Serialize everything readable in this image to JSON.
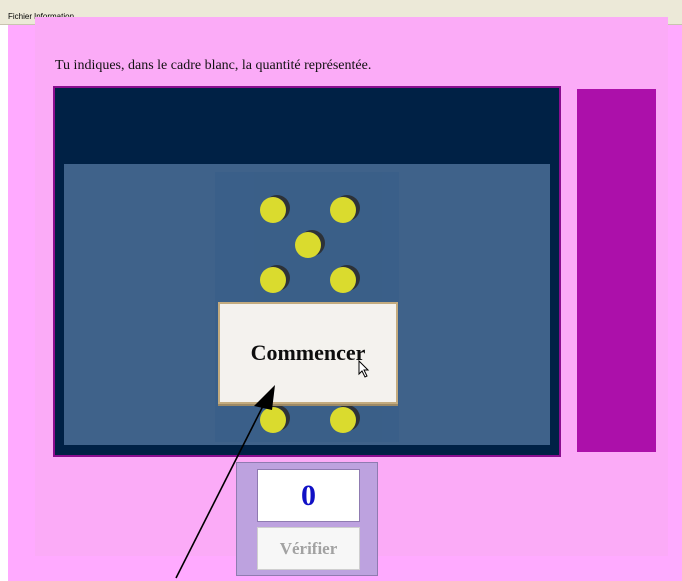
{
  "menu": {
    "items": [
      "Fichier",
      "Information"
    ]
  },
  "instruction": "Tu indiques, dans le cadre blanc, la quantité représentée.",
  "game": {
    "start_label": "Commencer"
  },
  "answer": {
    "value": "0",
    "verify_label": "Vérifier"
  },
  "colors": {
    "page_background": "#ffaaff",
    "frame_background": "#002145",
    "play_area": "#3f628a",
    "dot": "#f6f11e",
    "side_bar": "#ac10aa",
    "answer_panel": "#bda2df",
    "answer_text": "#1010c5"
  }
}
